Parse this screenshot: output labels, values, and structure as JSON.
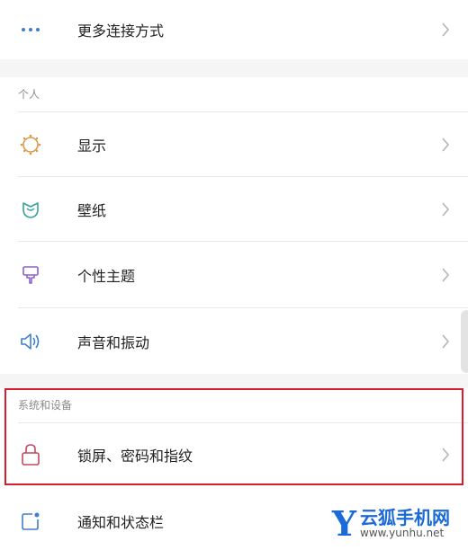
{
  "top_item": {
    "label": "更多连接方式",
    "icon": "more-dots-icon"
  },
  "personal": {
    "header": "个人",
    "items": [
      {
        "label": "显示",
        "icon": "sun-icon",
        "color": "#d99a4e"
      },
      {
        "label": "壁纸",
        "icon": "wallpaper-flower-icon",
        "color": "#3aa39a"
      },
      {
        "label": "个性主题",
        "icon": "theme-brush-icon",
        "color": "#8a62c7"
      },
      {
        "label": "声音和振动",
        "icon": "speaker-icon",
        "color": "#3f7fd0"
      }
    ]
  },
  "system": {
    "header": "系统和设备",
    "items": [
      {
        "label": "锁屏、密码和指纹",
        "icon": "lock-icon",
        "color": "#c4485f"
      },
      {
        "label": "通知和状态栏",
        "icon": "notification-icon",
        "color": "#3f7fd0"
      }
    ]
  },
  "highlight_color": "#d81e2c",
  "watermark": {
    "logo": "Y",
    "name": "云狐手机网",
    "url": "www.yunhu.net"
  }
}
